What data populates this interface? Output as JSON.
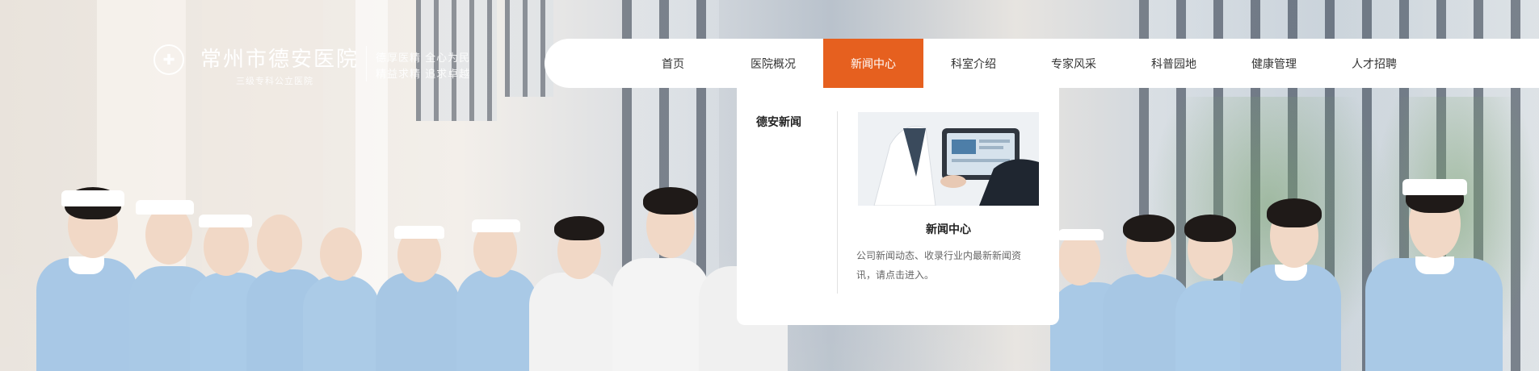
{
  "hospital": {
    "name": "常州市德安医院",
    "subtitle": "三级专科公立医院",
    "motto_line1": "德厚医精  全心为民",
    "motto_line2": "精益求精  追求卓越"
  },
  "nav": {
    "items": [
      {
        "label": "首页",
        "active": false
      },
      {
        "label": "医院概况",
        "active": false
      },
      {
        "label": "新闻中心",
        "active": true
      },
      {
        "label": "科室介绍",
        "active": false
      },
      {
        "label": "专家风采",
        "active": false
      },
      {
        "label": "科普园地",
        "active": false
      },
      {
        "label": "健康管理",
        "active": false
      },
      {
        "label": "人才招聘",
        "active": false
      }
    ],
    "accent_color": "#e6601f"
  },
  "dropdown": {
    "side_link": "德安新闻",
    "card_title": "新闻中心",
    "card_desc": "公司新闻动态、收录行业内最新新闻资讯，请点击进入。"
  },
  "icons": {
    "logo_emblem": "hospital-emblem-icon"
  }
}
